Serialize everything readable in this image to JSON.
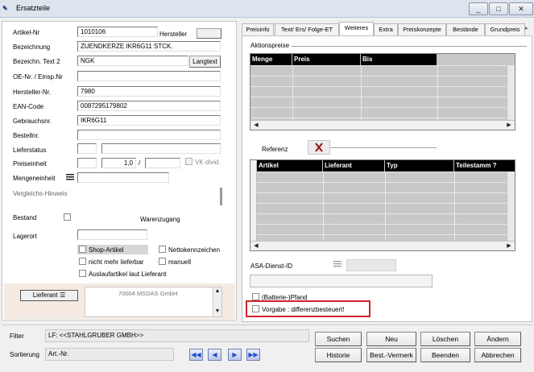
{
  "window": {
    "title": "Ersatzteile",
    "icon_text": "✎",
    "min": "_",
    "max": "□",
    "close": "✕"
  },
  "left": {
    "fields": [
      {
        "label": "Artikel-Nr",
        "value": "1010106"
      },
      {
        "label": "Bezeichnung",
        "value": "ZUENDKERZE IKR6G11 STCK."
      },
      {
        "label": "Bezeichn. Text 2",
        "value": "NGK"
      },
      {
        "label": "OE-Nr. / Einsp.Nr",
        "value": ""
      },
      {
        "label": "Hersteller-Nr.",
        "value": "7980"
      },
      {
        "label": "EAN-Code",
        "value": "0087295179802"
      },
      {
        "label": "Gebrauchsnr.",
        "value": "IKR6G11"
      },
      {
        "label": "Bestellnr.",
        "value": ""
      },
      {
        "label": "Lieferstatus",
        "value": ""
      },
      {
        "label": "Preiseinheit",
        "value": "1,0"
      },
      {
        "label": "Mengeneinheit",
        "value": ""
      }
    ],
    "hersteller_label": "Hersteller",
    "langtext_label": "Langtext",
    "preis_slash": "/",
    "vk_divid_label": "VK divid.",
    "vergleichs_label": "Vergleichs-Hinweis",
    "bestand_label": "Bestand",
    "warenzugang_label": "Warenzugang",
    "lagerort_label": "Lagerort",
    "checks": {
      "shop": "Shop-Artikel",
      "netto": "Nettokennzeichen",
      "nicht_lieferbar": "nicht mehr lieferbar",
      "manuell": "manuell",
      "auslauf": "Auslaufartikel laut Lieferant"
    },
    "lieferant_button": "Lieferant",
    "lieferant_value": "70004 MSDAS GmbH"
  },
  "tabs": [
    "Preisinfo",
    "Text/ Ers/ Folge-ET",
    "Weiteres",
    "Extra",
    "Preiskonzepte",
    "Bestände",
    "Grundpreis"
  ],
  "right": {
    "aktionspreise_label": "Aktionspreise",
    "aktion_cols": [
      "Menge",
      "Preis",
      "Bis"
    ],
    "referenz_label": "Referenz",
    "ref_cols": [
      "Artikel",
      "Lieferant",
      "Typ",
      "Teilestamm ?"
    ],
    "asa_label": "ASA-Dienst-ID",
    "pfand_label": "(Batterie-)Pfand",
    "vorgabe_label": "Vorgabe : differenzbesteuert!"
  },
  "bottom": {
    "filter_label": "Filter",
    "filter_value": "LF: <<STAHLGRUBER GMBH>>",
    "sort_label": "Sortierung",
    "sort_value": "Art.-Nr.",
    "buttons": [
      "Suchen",
      "Neu",
      "Löschen",
      "Ändern",
      "Historie",
      "Best.-Vermerk",
      "Beenden",
      "Abbrechen"
    ]
  },
  "colors": {
    "highlight_border": "#d0202a",
    "grid_header": "#000000",
    "nav_arrow": "#1f4fc8"
  }
}
